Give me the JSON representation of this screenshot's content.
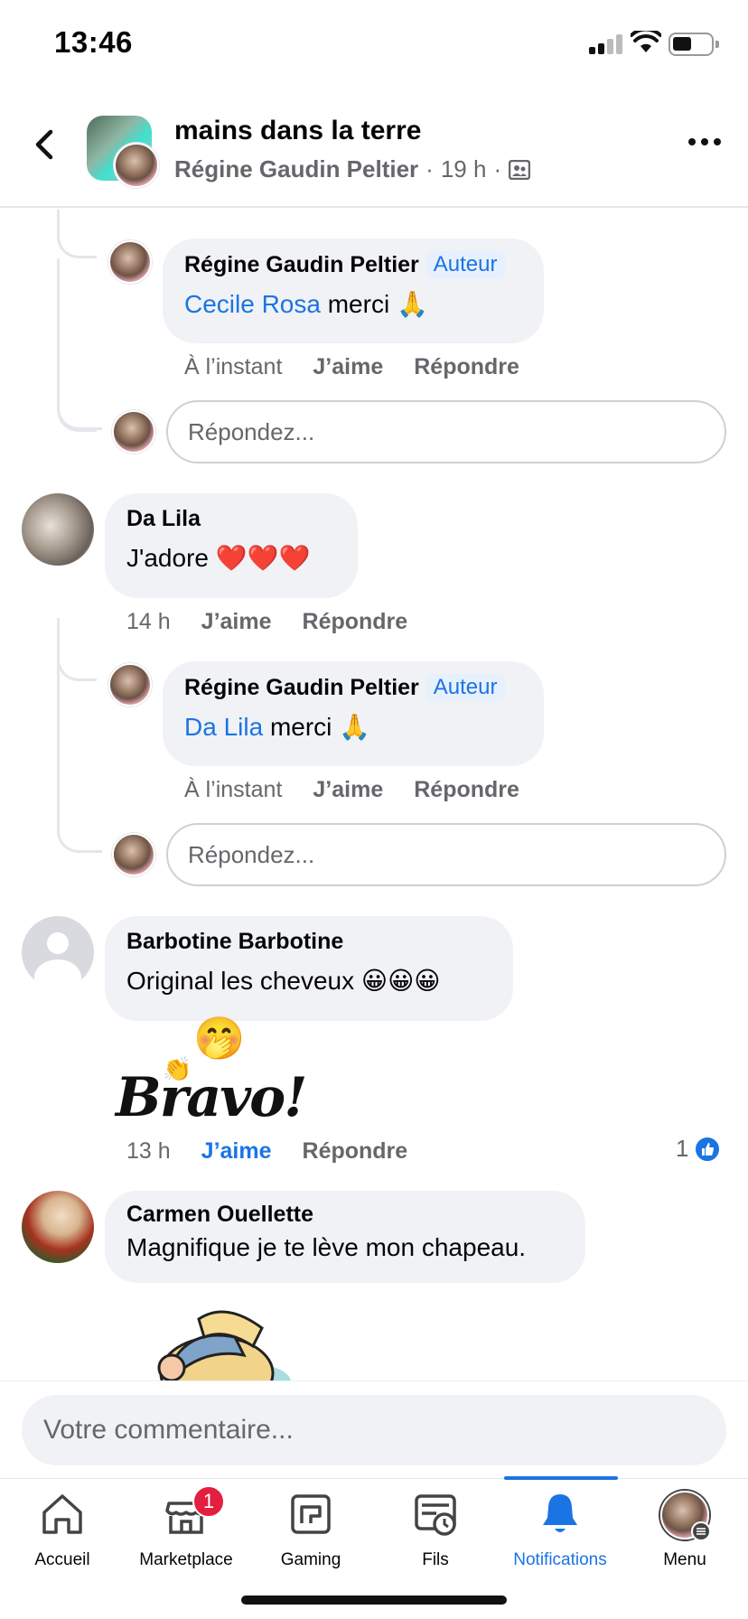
{
  "status_bar": {
    "time": "13:46"
  },
  "header": {
    "title": "mains dans la terre",
    "author": "Régine Gaudin Peltier",
    "time": "19 h"
  },
  "comments": [
    {
      "id": "reply-cecile",
      "author": "Régine Gaudin Peltier",
      "badge": "Auteur",
      "mention": "Cecile Rosa",
      "text": " merci 🙏",
      "time": "À l’instant",
      "like": "J’aime",
      "reply": "Répondre"
    },
    {
      "id": "da-lila",
      "author": "Da Lila",
      "text": "J'adore ❤️❤️❤️",
      "time": "14 h",
      "like": "J’aime",
      "reply": "Répondre"
    },
    {
      "id": "reply-dalila",
      "author": "Régine Gaudin Peltier",
      "badge": "Auteur",
      "mention": "Da Lila",
      "text": " merci 🙏",
      "time": "À l’instant",
      "like": "J’aime",
      "reply": "Répondre"
    },
    {
      "id": "barbotine",
      "author": "Barbotine Barbotine",
      "text": "Original les cheveux 😀😀😀",
      "sticker_text": "Bravo!",
      "time": "13 h",
      "like": "J’aime",
      "reply": "Répondre",
      "reaction_count": "1"
    },
    {
      "id": "carmen",
      "author": "Carmen Ouellette",
      "text": "Magnifique je te lève mon chapeau."
    }
  ],
  "reply_placeholder": "Répondez...",
  "composer_placeholder": "Votre commentaire...",
  "tabs": [
    {
      "label": "Accueil",
      "icon": "home-icon"
    },
    {
      "label": "Marketplace",
      "icon": "marketplace-icon",
      "badge": "1"
    },
    {
      "label": "Gaming",
      "icon": "gaming-icon"
    },
    {
      "label": "Fils",
      "icon": "feeds-icon"
    },
    {
      "label": "Notifications",
      "icon": "bell-icon",
      "active": true
    },
    {
      "label": "Menu",
      "icon": "profile-avatar"
    }
  ],
  "colors": {
    "accent": "#1b74e4",
    "bubble": "#f0f2f5",
    "badge_red": "#e41e3f"
  }
}
